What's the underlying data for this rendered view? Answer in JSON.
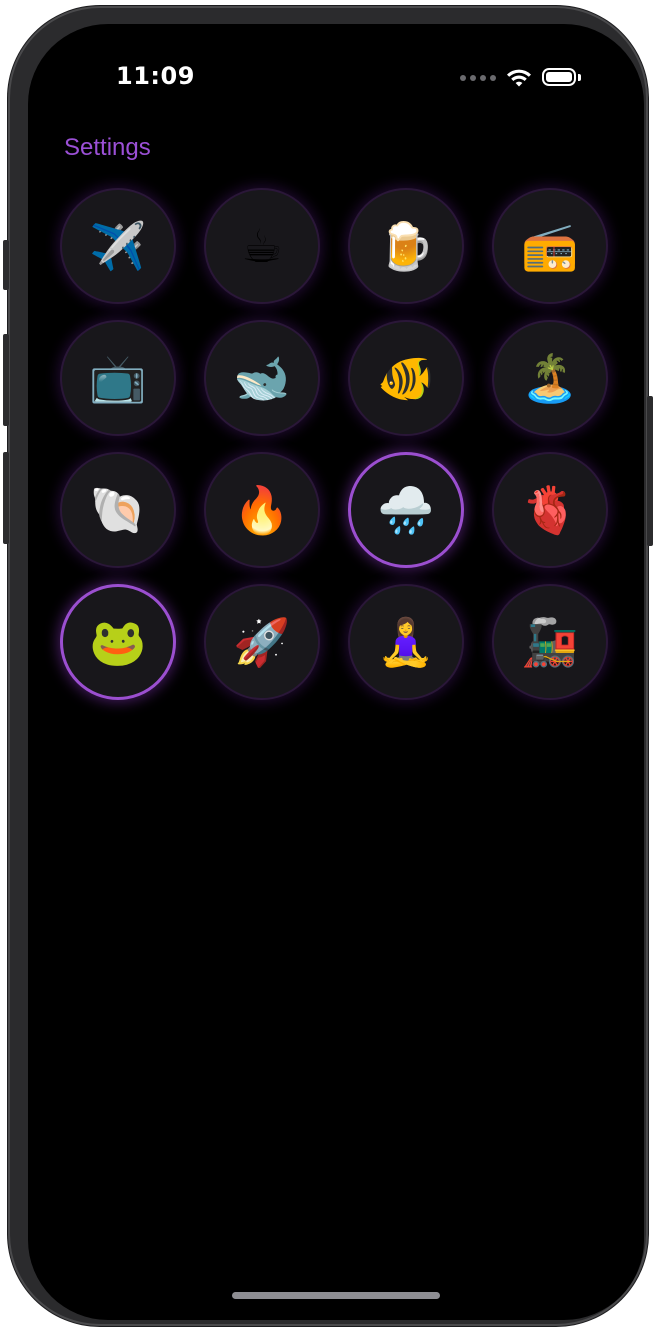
{
  "status_bar": {
    "time": "11:09",
    "signal_icon": "cellular-signal-icon",
    "wifi_icon": "wifi-icon",
    "battery_icon": "battery-icon"
  },
  "nav": {
    "back_label": "Settings",
    "accent_color": "#9b50d6"
  },
  "emoji_grid": {
    "items": [
      {
        "emoji": "✈️",
        "name": "airplane",
        "selected": false
      },
      {
        "emoji": "☕",
        "name": "coffee",
        "selected": false
      },
      {
        "emoji": "🍺",
        "name": "beer",
        "selected": false
      },
      {
        "emoji": "📻",
        "name": "radio",
        "selected": false
      },
      {
        "emoji": "📺",
        "name": "television",
        "selected": false
      },
      {
        "emoji": "🐋",
        "name": "whale",
        "selected": false
      },
      {
        "emoji": "🐠",
        "name": "tropical-fish",
        "selected": false
      },
      {
        "emoji": "🏝️",
        "name": "island",
        "selected": false
      },
      {
        "emoji": "🐚",
        "name": "shell",
        "selected": false
      },
      {
        "emoji": "🔥",
        "name": "fire",
        "selected": false
      },
      {
        "emoji": "🌧️",
        "name": "rain-cloud",
        "selected": true
      },
      {
        "emoji": "🫀",
        "name": "anatomical-heart",
        "selected": false
      },
      {
        "emoji": "🐸",
        "name": "frog",
        "selected": true
      },
      {
        "emoji": "🚀",
        "name": "rocket",
        "selected": false
      },
      {
        "emoji": "🧘‍♀️",
        "name": "yoga",
        "selected": false
      },
      {
        "emoji": "🚂",
        "name": "locomotive",
        "selected": false
      }
    ]
  },
  "colors": {
    "background": "#000000",
    "cell_background": "#18171b",
    "selected_ring": "#9b4fd0"
  }
}
